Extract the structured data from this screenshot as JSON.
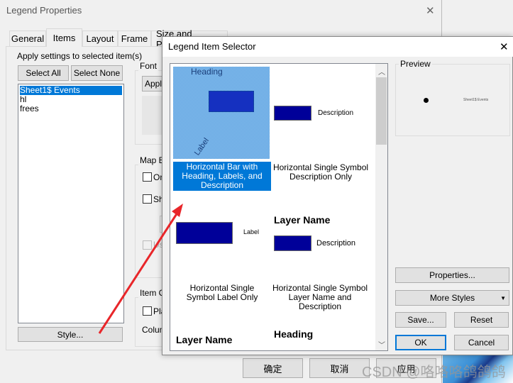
{
  "outer": {
    "title": "Legend Properties",
    "close": "✕",
    "tabs": [
      {
        "label": "General"
      },
      {
        "label": "Items"
      },
      {
        "label": "Layout"
      },
      {
        "label": "Frame"
      },
      {
        "label": "Size and Position"
      }
    ],
    "apply_settings_label": "Apply settings to selected item(s)",
    "select_all": "Select All",
    "select_none": "Select None",
    "items": [
      "Sheet1$ Events",
      "hl",
      "frees"
    ],
    "style_button": "Style...",
    "font_group": "Font",
    "font_apply": "Apply",
    "map_extent_group": "Map E",
    "map_extent_opt1": "On",
    "map_extent_opt2": "Sh",
    "map_extent_opt3": "Us",
    "item_column_group": "Item C",
    "item_column_opt": "Pla",
    "column_label": "Colum",
    "ok": "确定",
    "cancel": "取消",
    "apply": "应用"
  },
  "selector": {
    "title": "Legend Item Selector",
    "close": "✕",
    "styles": [
      {
        "caption": "Horizontal Bar with Heading, Labels, and Description",
        "heading": "Heading",
        "label": "Label",
        "selected": true
      },
      {
        "caption": "Horizontal Single Symbol Description Only",
        "description": "Description"
      },
      {
        "caption": "Horizontal Single Symbol Label Only",
        "label": "Label"
      },
      {
        "caption": "Horizontal Single Symbol Layer Name and Description",
        "layer_name": "Layer Name",
        "description": "Description"
      },
      {
        "layer_name": "Layer Name"
      },
      {
        "heading": "Heading"
      }
    ],
    "preview_label": "Preview",
    "preview_text": "Sheet1$ Events",
    "properties": "Properties...",
    "more_styles": "More Styles",
    "save": "Save...",
    "reset": "Reset",
    "ok": "OK",
    "cancel": "Cancel"
  },
  "watermark": "CSDN @咯咯咯鸽鸽鸽",
  "colors": {
    "selection": "#0078d7",
    "symbol": "#000099",
    "arrow": "#e8262a"
  }
}
